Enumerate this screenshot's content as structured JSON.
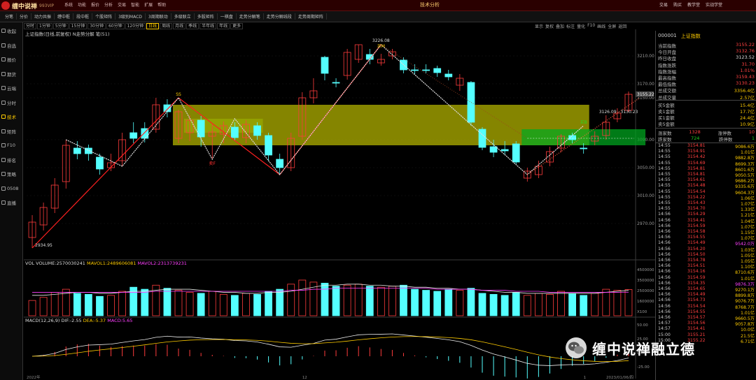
{
  "app": {
    "name": "缠中说禅",
    "version": "993VIP",
    "window_title": "技术分析",
    "top_menu": [
      "系统",
      "功能",
      "报价",
      "分析",
      "交易",
      "智能",
      "扩展",
      "帮助"
    ],
    "title_right": [
      "交易",
      "购买",
      "教学堂",
      "实战学堂"
    ]
  },
  "toolbar": [
    "分笔",
    "分价",
    "动力共振",
    "缠中枢",
    "段中枢",
    "个股矩阵",
    "3级别MACD",
    "3周期联动",
    "多级联立",
    "多股矩阵",
    "一棋盘",
    "走势分解笔",
    "走势分解线段",
    "走势周期矩阵"
  ],
  "sidebar": [
    {
      "label": "收起",
      "icon": "collapse-icon"
    },
    {
      "label": "自选",
      "icon": "star-icon"
    },
    {
      "label": "报价",
      "icon": "quote-icon"
    },
    {
      "label": "期货",
      "icon": "futures-icon"
    },
    {
      "label": "云端",
      "icon": "cloud-icon"
    },
    {
      "label": "分时",
      "icon": "clock-icon"
    },
    {
      "label": "技术",
      "icon": "kline-icon",
      "active": true
    },
    {
      "label": "矩阵",
      "icon": "matrix-icon"
    },
    {
      "label": "F10",
      "icon": "f10-icon"
    },
    {
      "label": "排名",
      "icon": "rank-icon"
    },
    {
      "label": "策略",
      "icon": "strategy-icon"
    },
    {
      "label": "0508",
      "icon": "code-icon"
    },
    {
      "label": "直播",
      "icon": "live-icon"
    }
  ],
  "periods": [
    "分时",
    "1分钟",
    "5分钟",
    "15分钟",
    "30分钟",
    "60分钟",
    "120分钟",
    "日线",
    "周线",
    "月线",
    "季线",
    "半年线",
    "年线",
    "更多"
  ],
  "active_period": "日线",
  "chart_tools": [
    "显示",
    "复权",
    "叠加",
    "标注",
    "量化",
    "F10",
    "画线",
    "全屏",
    "返回"
  ],
  "main_legend": "上证指数(日线,前复权) N走势分解 笔(51)",
  "vol_legend": {
    "name": "VOL",
    "vol": "VOLUME:2570030241",
    "ma1": "MAVOL1:2489606081",
    "ma2": "MAVOL2:2313739231"
  },
  "macd_legend": {
    "name": "MACD(12,26,9)",
    "dif": "DIF:-2.55",
    "dea": "DEA:-5.37",
    "macd": "MACD:5.65"
  },
  "chart_labels": {
    "high": "3226.08",
    "low": "2934.95",
    "mark_ss": "SS",
    "mark_mb": "买M",
    "mark_sf": "卖F",
    "mark_b": "买B",
    "hline_text": "3126.09 - 3130.23",
    "x_ticks": [
      "2022年",
      "12",
      "1",
      "2023/01/06/四"
    ]
  },
  "price_ticks": [
    "3210.00",
    "3170.00",
    "3150.00",
    "3090.00",
    "3050.00",
    "3010.00",
    "2970.00"
  ],
  "vol_ticks": [
    "4500000",
    "3500000",
    "2500000",
    "1600000",
    "X100"
  ],
  "macd_ticks": [
    "50.00",
    "25.00",
    "0.00",
    "-25.00"
  ],
  "last_price_tag": "3155.22",
  "quote": {
    "code": "000001",
    "name": "上证指数",
    "rows": [
      {
        "label": "当前指数",
        "value": "3155.22",
        "cls": "up"
      },
      {
        "label": "今日开盘",
        "value": "3132.76",
        "cls": "up"
      },
      {
        "label": "昨日收盘",
        "value": "3123.52",
        "cls": "wh"
      },
      {
        "label": "指数涨跌",
        "value": "31.70",
        "cls": "up"
      },
      {
        "label": "指数涨幅",
        "value": "1.01%",
        "cls": "up"
      },
      {
        "label": "最高指数",
        "value": "3159.43",
        "cls": "up"
      },
      {
        "label": "最低指数",
        "value": "3130.23",
        "cls": "up"
      },
      {
        "label": "总成交额",
        "value": "3356.4亿",
        "cls": "yl"
      },
      {
        "label": "总成交量",
        "value": "2.57亿",
        "cls": "yl"
      }
    ],
    "money_rows": [
      {
        "label": "买5金额",
        "value": "15.4亿",
        "cls": "yl"
      },
      {
        "label": "卖1金额",
        "value": "17.7亿",
        "cls": "yl"
      },
      {
        "label": "买1金额",
        "value": "24.4亿",
        "cls": "yl"
      },
      {
        "label": "卖5金额",
        "value": "10.9亿",
        "cls": "yl"
      }
    ],
    "breadth": [
      {
        "l1": "涨家数",
        "v1": "1328",
        "l2": "涨停数",
        "v2": "10"
      },
      {
        "l1": "跌家数",
        "v1": "724",
        "l2": "跌停数",
        "v2": "1"
      }
    ],
    "ticks": [
      {
        "t": "14:55",
        "p": "3154.81",
        "v": "9086.6万",
        "big": false
      },
      {
        "t": "14:55",
        "p": "3154.91",
        "v": "1.01亿",
        "big": false
      },
      {
        "t": "14:55",
        "p": "3154.42",
        "v": "9882.8万",
        "big": false
      },
      {
        "t": "14:55",
        "p": "3154.69",
        "v": "8699.3万",
        "big": false
      },
      {
        "t": "14:55",
        "p": "3154.81",
        "v": "8601.6万",
        "big": false
      },
      {
        "t": "14:55",
        "p": "3154.81",
        "v": "9050.5万",
        "big": false
      },
      {
        "t": "14:55",
        "p": "3154.61",
        "v": "9686.2万",
        "big": false
      },
      {
        "t": "14:55",
        "p": "3154.48",
        "v": "9335.6万",
        "big": false
      },
      {
        "t": "14:55",
        "p": "3154.54",
        "v": "9604.3万",
        "big": false
      },
      {
        "t": "14:55",
        "p": "3154.22",
        "v": "1.06亿",
        "big": false
      },
      {
        "t": "14:55",
        "p": "3154.43",
        "v": "1.07亿",
        "big": false
      },
      {
        "t": "14:55",
        "p": "3154.70",
        "v": "1.33亿",
        "big": false
      },
      {
        "t": "14:56",
        "p": "3154.29",
        "v": "1.21亿",
        "big": false
      },
      {
        "t": "14:56",
        "p": "3154.41",
        "v": "1.04亿",
        "big": false
      },
      {
        "t": "14:56",
        "p": "3154.59",
        "v": "1.07亿",
        "big": false
      },
      {
        "t": "14:56",
        "p": "3154.58",
        "v": "1.15亿",
        "big": false
      },
      {
        "t": "14:56",
        "p": "3154.55",
        "v": "1.07亿",
        "big": false
      },
      {
        "t": "14:56",
        "p": "3154.49",
        "v": "9542.0万",
        "big": true
      },
      {
        "t": "14:56",
        "p": "3154.20",
        "v": "1.03亿",
        "big": false
      },
      {
        "t": "14:56",
        "p": "3154.50",
        "v": "1.05亿",
        "big": false
      },
      {
        "t": "14:56",
        "p": "3154.78",
        "v": "1.05亿",
        "big": false
      },
      {
        "t": "14:56",
        "p": "3154.51",
        "v": "1.10亿",
        "big": false
      },
      {
        "t": "14:56",
        "p": "3154.16",
        "v": "8710.6万",
        "big": false
      },
      {
        "t": "14:56",
        "p": "3154.59",
        "v": "1.01亿",
        "big": false
      },
      {
        "t": "14:56",
        "p": "3154.35",
        "v": "9876.3万",
        "big": true
      },
      {
        "t": "14:56",
        "p": "3154.65",
        "v": "9270.1万",
        "big": false
      },
      {
        "t": "14:56",
        "p": "3154.49",
        "v": "8899.8万",
        "big": false
      },
      {
        "t": "14:56",
        "p": "3154.73",
        "v": "9076.7万",
        "big": false
      },
      {
        "t": "14:56",
        "p": "3154.54",
        "v": "8768.7万",
        "big": false
      },
      {
        "t": "14:56",
        "p": "3154.55",
        "v": "1.01亿",
        "big": false
      },
      {
        "t": "14:56",
        "p": "3154.57",
        "v": "9660.5万",
        "big": false
      },
      {
        "t": "14:57",
        "p": "3154.56",
        "v": "9057.8万",
        "big": false
      },
      {
        "t": "14:57",
        "p": "3154.41",
        "v": "10.0亿",
        "big": false
      },
      {
        "t": "15:00",
        "p": "3155.21",
        "v": "21.5亿",
        "big": false
      },
      {
        "t": "15:00",
        "p": "3155.22",
        "v": "6.71亿",
        "big": false
      }
    ]
  },
  "watermark": "缠中说禅融立德",
  "chart_data": {
    "type": "candlestick",
    "ylim": [
      2920,
      3240
    ],
    "candles": [
      {
        "o": 2950,
        "c": 2972,
        "h": 2982,
        "l": 2935,
        "up": true
      },
      {
        "o": 2968,
        "c": 2993,
        "h": 3000,
        "l": 2960,
        "up": true
      },
      {
        "o": 2992,
        "c": 3025,
        "h": 3035,
        "l": 2985,
        "up": true
      },
      {
        "o": 3030,
        "c": 3082,
        "h": 3090,
        "l": 3020,
        "up": true
      },
      {
        "o": 3078,
        "c": 3070,
        "h": 3088,
        "l": 3062,
        "up": false
      },
      {
        "o": 3078,
        "c": 3070,
        "h": 3083,
        "l": 3060,
        "up": false
      },
      {
        "o": 3065,
        "c": 3048,
        "h": 3070,
        "l": 3040,
        "up": false
      },
      {
        "o": 3050,
        "c": 3057,
        "h": 3070,
        "l": 3045,
        "up": true
      },
      {
        "o": 3060,
        "c": 3090,
        "h": 3100,
        "l": 3052,
        "up": true
      },
      {
        "o": 3092,
        "c": 3100,
        "h": 3115,
        "l": 3085,
        "up": false
      },
      {
        "o": 3092,
        "c": 3106,
        "h": 3115,
        "l": 3086,
        "up": false
      },
      {
        "o": 3105,
        "c": 3140,
        "h": 3150,
        "l": 3100,
        "up": true
      },
      {
        "o": 3140,
        "c": 3130,
        "h": 3148,
        "l": 3122,
        "up": false
      },
      {
        "o": 3130,
        "c": 3092,
        "h": 3133,
        "l": 3085,
        "up": true
      },
      {
        "o": 3100,
        "c": 3118,
        "h": 3125,
        "l": 3088,
        "up": true
      },
      {
        "o": 3118,
        "c": 3094,
        "h": 3124,
        "l": 3080,
        "up": false
      },
      {
        "o": 3095,
        "c": 3101,
        "h": 3112,
        "l": 3062,
        "up": true
      },
      {
        "o": 3098,
        "c": 3110,
        "h": 3116,
        "l": 3085,
        "up": true
      },
      {
        "o": 3108,
        "c": 3093,
        "h": 3115,
        "l": 3088,
        "up": false
      },
      {
        "o": 3093,
        "c": 3112,
        "h": 3118,
        "l": 3085,
        "up": true
      },
      {
        "o": 3110,
        "c": 3096,
        "h": 3115,
        "l": 3090,
        "up": false
      },
      {
        "o": 3096,
        "c": 3068,
        "h": 3100,
        "l": 3060,
        "up": false
      },
      {
        "o": 3062,
        "c": 3050,
        "h": 3070,
        "l": 3040,
        "up": false
      },
      {
        "o": 3050,
        "c": 3092,
        "h": 3100,
        "l": 3045,
        "up": true
      },
      {
        "o": 3095,
        "c": 3150,
        "h": 3158,
        "l": 3090,
        "up": true
      },
      {
        "o": 3150,
        "c": 3160,
        "h": 3178,
        "l": 3142,
        "up": true
      },
      {
        "o": 3185,
        "c": 3208,
        "h": 3210,
        "l": 3175,
        "up": false
      },
      {
        "o": 3172,
        "c": 3172,
        "h": 3178,
        "l": 3165,
        "up": false
      },
      {
        "o": 3182,
        "c": 3215,
        "h": 3220,
        "l": 3176,
        "up": true
      },
      {
        "o": 3205,
        "c": 3226,
        "h": 3226,
        "l": 3200,
        "up": true
      },
      {
        "o": 3212,
        "c": 3205,
        "h": 3220,
        "l": 3198,
        "up": false
      },
      {
        "o": 3200,
        "c": 3205,
        "h": 3213,
        "l": 3196,
        "up": true
      },
      {
        "o": 3210,
        "c": 3216,
        "h": 3220,
        "l": 3205,
        "up": true
      },
      {
        "o": 3204,
        "c": 3190,
        "h": 3208,
        "l": 3185,
        "up": false
      },
      {
        "o": 3190,
        "c": 3190,
        "h": 3198,
        "l": 3184,
        "up": false
      },
      {
        "o": 3190,
        "c": 3190,
        "h": 3198,
        "l": 3185,
        "up": false
      },
      {
        "o": 3192,
        "c": 3186,
        "h": 3196,
        "l": 3180,
        "up": false
      },
      {
        "o": 3184,
        "c": 3180,
        "h": 3190,
        "l": 3175,
        "up": false
      },
      {
        "o": 3178,
        "c": 3168,
        "h": 3184,
        "l": 3160,
        "up": true
      },
      {
        "o": 3172,
        "c": 3115,
        "h": 3174,
        "l": 3110,
        "up": false
      },
      {
        "o": 3105,
        "c": 3079,
        "h": 3108,
        "l": 3075,
        "up": false
      },
      {
        "o": 3080,
        "c": 3072,
        "h": 3090,
        "l": 3065,
        "up": false
      },
      {
        "o": 3074,
        "c": 3076,
        "h": 3088,
        "l": 3068,
        "up": false
      },
      {
        "o": 3084,
        "c": 3058,
        "h": 3088,
        "l": 3055,
        "up": false
      },
      {
        "o": 3045,
        "c": 3035,
        "h": 3050,
        "l": 3030,
        "up": true
      },
      {
        "o": 3040,
        "c": 3052,
        "h": 3060,
        "l": 3035,
        "up": true
      },
      {
        "o": 3058,
        "c": 3073,
        "h": 3080,
        "l": 3052,
        "up": true
      },
      {
        "o": 3078,
        "c": 3095,
        "h": 3098,
        "l": 3072,
        "up": true
      },
      {
        "o": 3096,
        "c": 3090,
        "h": 3100,
        "l": 3085,
        "up": false
      },
      {
        "o": 3078,
        "c": 3078,
        "h": 3085,
        "l": 3070,
        "up": false
      },
      {
        "o": 3088,
        "c": 3095,
        "h": 3102,
        "l": 3082,
        "up": true
      },
      {
        "o": 3096,
        "c": 3115,
        "h": 3125,
        "l": 3090,
        "up": true
      },
      {
        "o": 3120,
        "c": 3128,
        "h": 3135,
        "l": 3115,
        "up": true
      },
      {
        "o": 3132,
        "c": 3155,
        "h": 3159,
        "l": 3130,
        "up": true
      }
    ],
    "volumes": [
      1.5,
      1.8,
      2.3,
      2.6,
      2.2,
      2.1,
      1.9,
      2.0,
      2.4,
      2.8,
      2.6,
      3.0,
      2.7,
      2.5,
      2.3,
      2.2,
      2.4,
      2.1,
      2.0,
      2.2,
      2.1,
      2.4,
      2.6,
      3.1,
      3.5,
      3.3,
      3.2,
      2.9,
      3.0,
      3.1,
      2.9,
      2.8,
      2.9,
      3.0,
      2.6,
      2.5,
      2.4,
      2.6,
      2.5,
      2.7,
      2.2,
      2.1,
      2.0,
      2.3,
      2.0,
      2.2,
      2.1,
      2.4,
      2.2,
      2.0,
      2.2,
      2.6,
      2.5,
      2.57
    ],
    "mavol1": [
      2.0,
      2.0,
      2.1,
      2.2,
      2.3,
      2.3,
      2.2,
      2.2,
      2.3,
      2.4,
      2.4,
      2.5,
      2.6,
      2.6,
      2.6,
      2.5,
      2.4,
      2.3,
      2.3,
      2.2,
      2.2,
      2.3,
      2.3,
      2.4,
      2.6,
      2.8,
      3.0,
      3.0,
      3.1,
      3.1,
      3.0,
      3.0,
      2.9,
      2.9,
      2.8,
      2.8,
      2.7,
      2.7,
      2.6,
      2.6,
      2.5,
      2.4,
      2.3,
      2.3,
      2.2,
      2.2,
      2.2,
      2.2,
      2.2,
      2.2,
      2.2,
      2.3,
      2.4,
      2.49
    ],
    "mavol2": [
      2.3,
      2.3,
      2.3,
      2.3,
      2.3,
      2.3,
      2.3,
      2.3,
      2.3,
      2.3,
      2.3,
      2.4,
      2.4,
      2.4,
      2.4,
      2.4,
      2.4,
      2.4,
      2.4,
      2.4,
      2.4,
      2.4,
      2.4,
      2.5,
      2.5,
      2.6,
      2.6,
      2.7,
      2.7,
      2.7,
      2.7,
      2.7,
      2.7,
      2.7,
      2.7,
      2.7,
      2.6,
      2.6,
      2.6,
      2.6,
      2.5,
      2.5,
      2.5,
      2.4,
      2.4,
      2.4,
      2.3,
      2.3,
      2.3,
      2.3,
      2.3,
      2.3,
      2.3,
      2.31
    ],
    "zones": [
      {
        "from": 13,
        "to": 49,
        "high": 3140,
        "low": 3082,
        "color": "#b8b800"
      },
      {
        "from": 14,
        "to": 20,
        "high": 3120,
        "low": 3100,
        "color": "#99aa00"
      },
      {
        "from": 44,
        "to": 54,
        "high": 3105,
        "low": 3082,
        "color": "#00aa20"
      }
    ],
    "bi_red": [
      [
        0,
        2935
      ],
      [
        13,
        3150
      ],
      [
        22,
        3040
      ],
      [
        31,
        3226
      ]
    ],
    "bi_white": [
      [
        3,
        3090
      ],
      [
        8,
        3052
      ],
      [
        13,
        3150
      ],
      [
        16,
        3062
      ],
      [
        18,
        3120
      ],
      [
        22,
        3040
      ],
      [
        31,
        3226
      ],
      [
        44,
        3040
      ],
      [
        49,
        3110
      ]
    ],
    "bi_dotted": [
      [
        44,
        3040
      ],
      [
        54,
        3150
      ]
    ]
  }
}
